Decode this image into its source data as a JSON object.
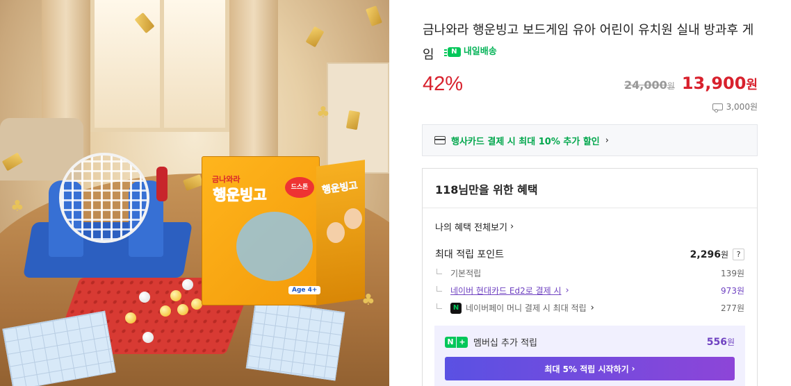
{
  "product": {
    "title": "금나와라 행운빙고 보드게임 유아 어린이 유치원 실내 방과후 게임",
    "delivery_badge": "내일배송",
    "delivery_icon": "truck-icon",
    "box_text": {
      "logo_small": "금나와라",
      "logo_main": "행운빙고",
      "side_title": "행운빙고",
      "sticker": "드스톤",
      "age": "Age 4+"
    }
  },
  "price": {
    "discount": "42%",
    "original": "24,000",
    "original_unit": "원",
    "sale": "13,900",
    "sale_unit": "원",
    "shipping": "3,000원"
  },
  "promo": {
    "text": "행사카드 결제 시 최대 10% 추가 할인",
    "chevron": "›"
  },
  "benefit": {
    "title": "118님만을 위한 혜택",
    "my_benefits_label": "나의 혜택 전체보기",
    "chevron": "›",
    "max_points_label": "최대 적립 포인트",
    "max_points_value": "2,296",
    "max_points_unit": "원",
    "help": "?",
    "rows": [
      {
        "label": "기본적립",
        "value": "139원"
      },
      {
        "label": "네이버 현대카드 Ed2로 결제 시",
        "value": "973원"
      },
      {
        "label": "네이버페이 머니 결제 시 최대 적립",
        "value": "277원"
      }
    ],
    "membership": {
      "label": "멤버십 추가 적립",
      "value": "556",
      "unit": "원",
      "button": "최대 5% 적립 시작하기",
      "button_chevron": "›"
    }
  },
  "colors": {
    "sale_red": "#d8212d",
    "naver_green": "#03c75a",
    "purple": "#6f42c1"
  }
}
